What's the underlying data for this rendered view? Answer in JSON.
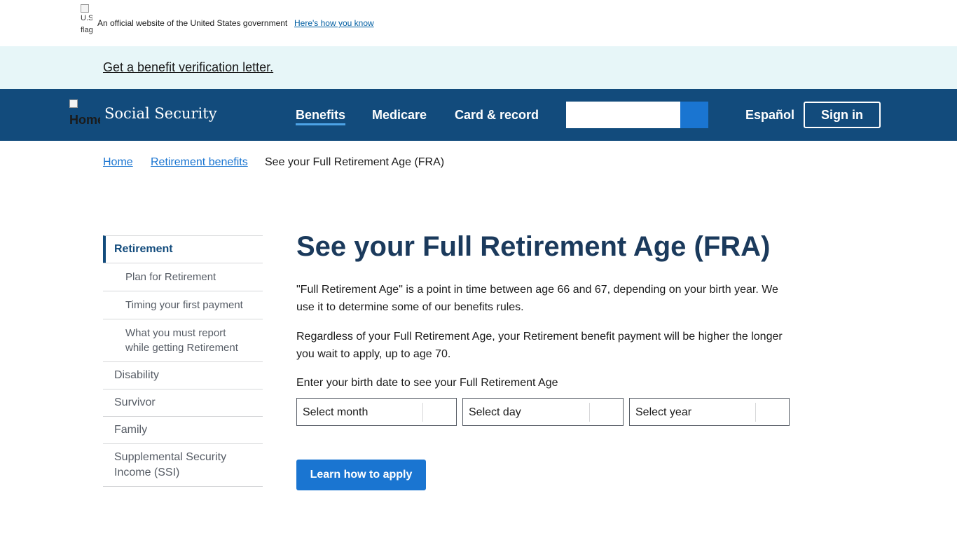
{
  "gov_banner": {
    "flag_alt": "U.S. flag",
    "text": "An official website of the United States government",
    "link": "Here's how you know"
  },
  "alert": {
    "link": "Get a benefit verification letter."
  },
  "header": {
    "logo_alt": "Home",
    "site_title": "Social Security",
    "nav": [
      "Benefits",
      "Medicare",
      "Card & record"
    ],
    "active_nav": "Benefits",
    "search": {
      "value": "",
      "placeholder": ""
    },
    "language": "Español",
    "sign_in": "Sign in"
  },
  "breadcrumb": {
    "items": [
      "Home",
      "Retirement benefits"
    ],
    "current": "See your Full Retirement Age (FRA)"
  },
  "sidenav": {
    "items": [
      {
        "label": "Retirement",
        "active": true
      },
      {
        "label": "Plan for Retirement",
        "sub": true
      },
      {
        "label": "Timing your first payment",
        "sub": true
      },
      {
        "label": "What you must report while getting Retirement",
        "sub": true
      },
      {
        "label": "Disability"
      },
      {
        "label": "Survivor"
      },
      {
        "label": "Family"
      },
      {
        "label": "Supplemental Security Income (SSI)"
      }
    ]
  },
  "main": {
    "title": "See your Full Retirement Age (FRA)",
    "para1": "\"Full Retirement Age\" is a point in time between age 66 and 67, depending on your birth year. We use it to determine some of our benefits rules.",
    "para2": "Regardless of your Full Retirement Age, your Retirement benefit payment will be higher the longer you wait to apply, up to age 70.",
    "prompt": "Enter your birth date to see your Full Retirement Age",
    "selects": {
      "month": "Select month",
      "day": "Select day",
      "year": "Select year"
    },
    "apply_button": "Learn how to apply"
  },
  "colors": {
    "header_bg": "#124b7c",
    "alert_bg": "#e7f6f8",
    "accent": "#1a75d1",
    "title": "#1b3a5c"
  }
}
